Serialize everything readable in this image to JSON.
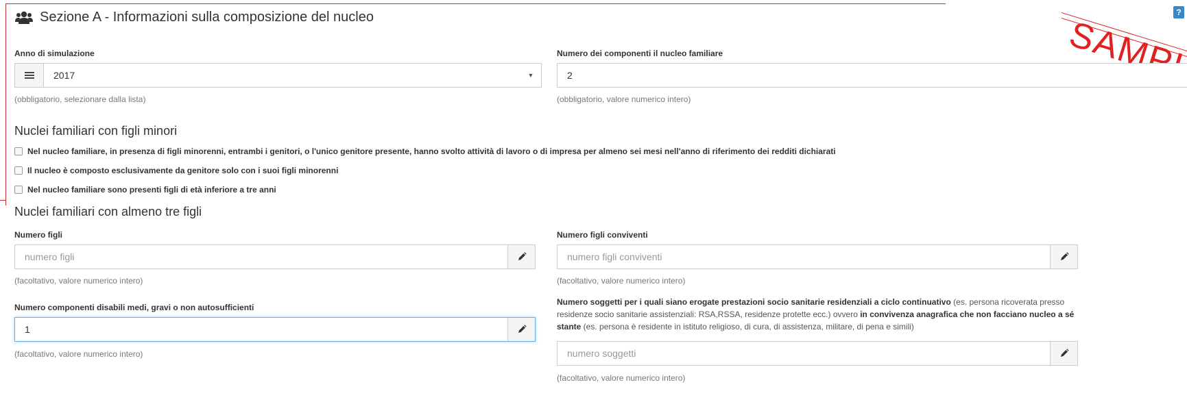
{
  "header": {
    "title": "Sezione A - Informazioni sulla composizione del nucleo",
    "help": "?"
  },
  "watermark": "SAMPLE",
  "fields": {
    "anno": {
      "label": "Anno di simulazione",
      "value": "2017",
      "help": "(obbligatorio, selezionare dalla lista)"
    },
    "componenti": {
      "label": "Numero dei componenti il nucleo familiare",
      "value": "2",
      "help": "(obbligatorio, valore numerico intero)"
    },
    "numero_figli": {
      "label": "Numero figli",
      "placeholder": "numero figli",
      "help": "(facoltativo, valore numerico intero)"
    },
    "figli_conviventi": {
      "label": "Numero figli conviventi",
      "placeholder": "numero figli conviventi",
      "help": "(facoltativo, valore numerico intero)"
    },
    "disabili": {
      "label": "Numero componenti disabili medi, gravi o non autosufficienti",
      "value": "1",
      "help": "(facoltativo, valore numerico intero)"
    },
    "soggetti": {
      "label_p1": "Numero soggetti per i quali siano erogate prestazioni socio sanitarie residenziali a ciclo continuativo",
      "label_p2": " (es. persona ricoverata presso residenze socio sanitarie assistenziali: RSA,RSSA, residenze protette ecc.) ovvero ",
      "label_p3": "in convivenza anagrafica che non facciano nucleo a sé stante",
      "label_p4": " (es. persona è residente in istituto religioso, di cura, di assistenza, militare, di pena e simili)",
      "placeholder": "numero soggetti",
      "help": "(facoltativo, valore numerico intero)"
    }
  },
  "sections": {
    "minori": {
      "title": "Nuclei familiari con figli minori",
      "checkboxes": [
        "Nel nucleo familiare, in presenza di figli minorenni, entrambi i genitori, o l'unico genitore presente, hanno svolto attività di lavoro o di impresa per almeno sei mesi nell'anno di riferimento dei redditi dichiarati",
        "Il nucleo è composto esclusivamente da genitore solo con i suoi figli minorenni",
        "Nel nucleo familiare sono presenti figli di età inferiore a tre anni"
      ]
    },
    "tre_figli": {
      "title": "Nuclei familiari con almeno tre figli"
    }
  },
  "icons": {
    "header": "users-icon",
    "list": "list-icon",
    "edit": "pencil-icon"
  },
  "colors": {
    "panel_border": "#c9302c",
    "help_badge": "#3a87c8",
    "watermark": "#e32020",
    "focus_border": "#66afe9"
  }
}
